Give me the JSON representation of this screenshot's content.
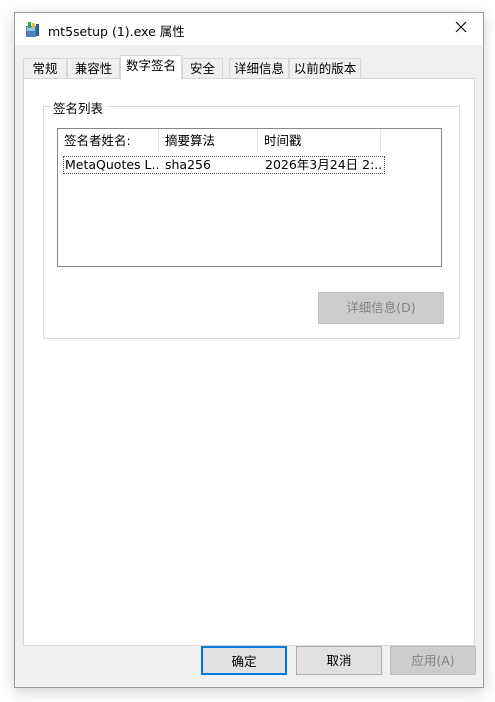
{
  "window": {
    "title": "mt5setup (1).exe 属性"
  },
  "tabs": [
    {
      "label": "常规"
    },
    {
      "label": "兼容性"
    },
    {
      "label": "数字签名"
    },
    {
      "label": "安全"
    },
    {
      "label": "详细信息"
    },
    {
      "label": "以前的版本"
    }
  ],
  "signature_list": {
    "group_label": "签名列表",
    "columns": [
      "签名者姓名:",
      "摘要算法",
      "时间戳"
    ],
    "rows": [
      {
        "signer": "MetaQuotes L...",
        "digest": "sha256",
        "timestamp": "2026年3月24日 2:..."
      }
    ],
    "details_button": "详细信息(D)"
  },
  "footer": {
    "ok": "确定",
    "cancel": "取消",
    "apply": "应用(A)"
  },
  "colors": {
    "accent": "#0078d7",
    "window_bg": "#f0f0f0",
    "disabled_button": "#cccccc"
  },
  "icons": {
    "app": "installer-icon",
    "close": "close-icon"
  }
}
